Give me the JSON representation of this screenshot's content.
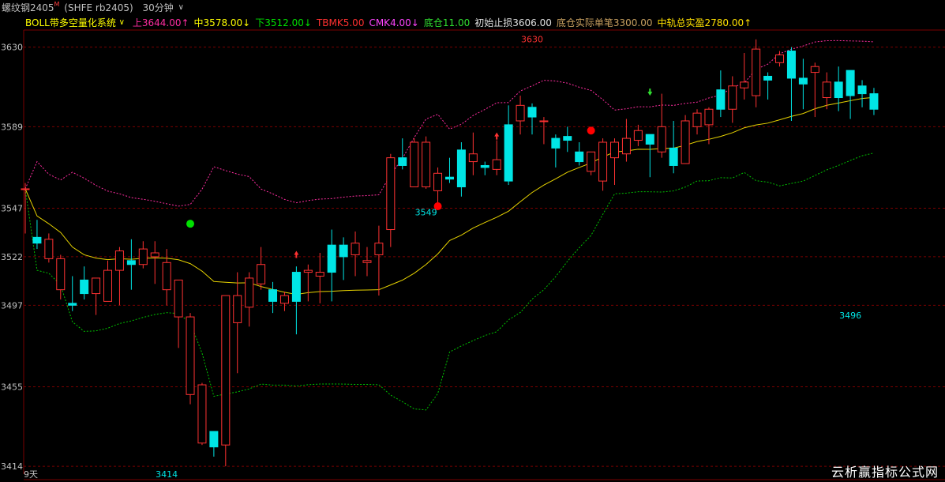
{
  "header": {
    "instrument": "螺纹钢2405",
    "instrument_suffix": "M",
    "code": "(SHFE rb2405)",
    "period": "30分钟",
    "period_arrow": "∨"
  },
  "indicator": {
    "name": "BOLL带多空量化系统",
    "name_arrow": "∨",
    "items": [
      {
        "label": "上",
        "value": "3644.00↑",
        "color": "#ff2da0"
      },
      {
        "label": "中",
        "value": "3578.00↓",
        "color": "#ffff00"
      },
      {
        "label": "下",
        "value": "3512.00↓",
        "color": "#00e000"
      },
      {
        "label": "TBMK",
        "value": "5.00",
        "color": "#ff3030"
      },
      {
        "label": "CMK",
        "value": "4.00↓",
        "color": "#ff44ff"
      },
      {
        "label": "底仓",
        "value": "11.00",
        "color": "#30e030"
      },
      {
        "label": "初始止损",
        "value": "3606.00",
        "color": "#e0e0e0"
      },
      {
        "label": "底仓实际单笔",
        "value": "3300.00",
        "color": "#c8a060"
      },
      {
        "label": "中轨总实盈",
        "value": "2780.00↑",
        "color": "#ffe000"
      }
    ]
  },
  "footer": {
    "days": "9天",
    "watermark": "云析赢指标公式网"
  },
  "colors": {
    "up": "#ff3232",
    "down": "#00e5e5",
    "upper_band": "#ff2da0",
    "mid_band": "#e6d200",
    "lower_band": "#00c000",
    "grid": "#7a0000",
    "axis_text": "#c0c0c0"
  },
  "chart_data": {
    "type": "candlestick",
    "ylim": [
      3410,
      3638
    ],
    "yticks": [
      3414,
      3455,
      3497,
      3522,
      3547,
      3589,
      3630
    ],
    "annotations": [
      {
        "text": "3630",
        "x": 43,
        "price": 3630,
        "color": "#ff3232"
      },
      {
        "text": "3549",
        "x": 34,
        "price": 3549,
        "color": "#00e5e5"
      },
      {
        "text": "3414",
        "x": 12,
        "price": 3414,
        "color": "#00e5e5"
      },
      {
        "text": "3496",
        "x": 70,
        "price": 3496,
        "color": "#00e5e5"
      }
    ],
    "signals": [
      {
        "type": "dot",
        "color": "#00e000",
        "x": 14,
        "price": 3539
      },
      {
        "type": "dot",
        "color": "#ff0000",
        "x": 35,
        "price": 3548
      },
      {
        "type": "dot",
        "color": "#ff0000",
        "x": 48,
        "price": 3587
      },
      {
        "type": "arrow-up",
        "color": "#ff3232",
        "x": 23,
        "price": 3523
      },
      {
        "type": "arrow-up",
        "color": "#ff3232",
        "x": 40,
        "price": 3584
      },
      {
        "type": "arrow-down",
        "color": "#30e030",
        "x": 53,
        "price": 3607
      }
    ],
    "candles": [
      [
        3557,
        3557,
        3560,
        3534
      ],
      [
        3532,
        3529,
        3541,
        3526
      ],
      [
        3521,
        3531,
        3534,
        3519
      ],
      [
        3505,
        3521,
        3523,
        3500
      ],
      [
        3498,
        3497,
        3512,
        3494
      ],
      [
        3510,
        3503,
        3517,
        3500
      ],
      [
        3503,
        3511,
        3511,
        3492
      ],
      [
        3499,
        3515,
        3520,
        3499
      ],
      [
        3515,
        3525,
        3527,
        3497
      ],
      [
        3520,
        3518,
        3531,
        3505
      ],
      [
        3518,
        3526,
        3530,
        3516
      ],
      [
        3522,
        3524,
        3530,
        3508
      ],
      [
        3505,
        3519,
        3526,
        3497
      ],
      [
        3491,
        3510,
        3510,
        3475
      ],
      [
        3451,
        3491,
        3493,
        3446
      ],
      [
        3426,
        3456,
        3457,
        3425
      ],
      [
        3432,
        3424,
        3427,
        3419
      ],
      [
        3425,
        3502,
        3502,
        3414
      ],
      [
        3488,
        3502,
        3514,
        3462
      ],
      [
        3496,
        3511,
        3514,
        3486
      ],
      [
        3508,
        3518,
        3527,
        3505
      ],
      [
        3505,
        3499,
        3509,
        3493
      ],
      [
        3498,
        3502,
        3504,
        3494
      ],
      [
        3514,
        3499,
        3517,
        3482
      ],
      [
        3514,
        3515,
        3518,
        3499
      ],
      [
        3512,
        3514,
        3524,
        3498
      ],
      [
        3528,
        3514,
        3536,
        3499
      ],
      [
        3528,
        3522,
        3532,
        3510
      ],
      [
        3523,
        3529,
        3535,
        3512
      ],
      [
        3519,
        3520,
        3527,
        3512
      ],
      [
        3523,
        3529,
        3538,
        3502
      ],
      [
        3536,
        3573,
        3575,
        3527
      ],
      [
        3573,
        3569,
        3583,
        3567
      ],
      [
        3558,
        3581,
        3583,
        3559
      ],
      [
        3558,
        3581,
        3584,
        3557
      ],
      [
        3556,
        3565,
        3568,
        3548
      ],
      [
        3563,
        3562,
        3573,
        3560
      ],
      [
        3577,
        3558,
        3581,
        3553
      ],
      [
        3571,
        3575,
        3586,
        3564
      ],
      [
        3569,
        3568,
        3571,
        3564
      ],
      [
        3567,
        3572,
        3582,
        3564
      ],
      [
        3590,
        3561,
        3600,
        3559
      ],
      [
        3592,
        3600,
        3605,
        3585
      ],
      [
        3599,
        3594,
        3601,
        3585
      ],
      [
        3592,
        3592,
        3594,
        3580
      ],
      [
        3583,
        3578,
        3585,
        3568
      ],
      [
        3584,
        3582,
        3589,
        3576
      ],
      [
        3576,
        3571,
        3581,
        3569
      ],
      [
        3566,
        3576,
        3576,
        3564
      ],
      [
        3561,
        3581,
        3583,
        3556
      ],
      [
        3573,
        3581,
        3583,
        3559
      ],
      [
        3575,
        3583,
        3593,
        3571
      ],
      [
        3582,
        3587,
        3590,
        3579
      ],
      [
        3585,
        3580,
        3585,
        3563
      ],
      [
        3576,
        3589,
        3606,
        3573
      ],
      [
        3578,
        3569,
        3592,
        3565
      ],
      [
        3570,
        3592,
        3595,
        3573
      ],
      [
        3589,
        3596,
        3598,
        3585
      ],
      [
        3590,
        3598,
        3599,
        3580
      ],
      [
        3608,
        3598,
        3618,
        3594
      ],
      [
        3598,
        3610,
        3615,
        3591
      ],
      [
        3609,
        3612,
        3627,
        3603
      ],
      [
        3605,
        3629,
        3634,
        3599
      ],
      [
        3615,
        3613,
        3617,
        3603
      ],
      [
        3622,
        3626,
        3628,
        3620
      ],
      [
        3628,
        3614,
        3630,
        3592
      ],
      [
        3614,
        3611,
        3624,
        3598
      ],
      [
        3617,
        3620,
        3622,
        3594
      ],
      [
        3604,
        3612,
        3617,
        3598
      ],
      [
        3612,
        3604,
        3620,
        3597
      ],
      [
        3618,
        3605,
        3616,
        3593
      ],
      [
        3610,
        3606,
        3613,
        3599
      ],
      [
        3606,
        3598,
        3609,
        3595
      ]
    ]
  }
}
